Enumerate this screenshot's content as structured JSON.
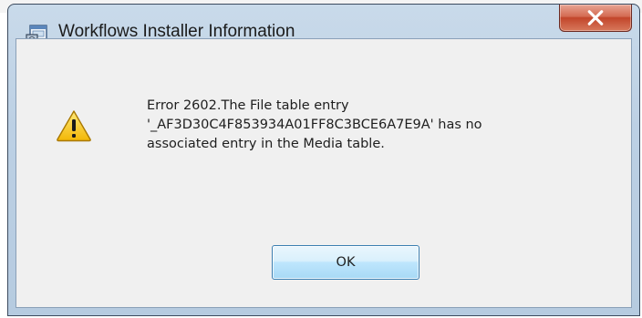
{
  "window": {
    "title": "Workflows Installer Information"
  },
  "message": {
    "lines": [
      "Error 2602.The File table entry",
      "'_AF3D30C4F853934A01FF8C3BCE6A7E9A' has no",
      "associated entry in the Media table."
    ]
  },
  "buttons": {
    "ok_label": "OK"
  },
  "icons": {
    "app": "installer-icon",
    "status": "warning-icon",
    "close": "close-icon"
  },
  "colors": {
    "close_button": "#c7472d",
    "ok_button_border": "#3c7fb1",
    "client_background": "#f0f0f0",
    "frame": "#bcd0e4"
  }
}
